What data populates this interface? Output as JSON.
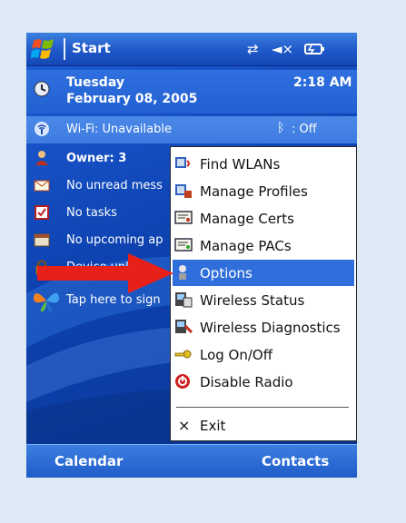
{
  "titlebar": {
    "title": "Start",
    "icons": [
      "windows-flag-icon",
      "connectivity-icon",
      "speaker-muted-icon",
      "battery-icon"
    ]
  },
  "today": {
    "day": "Tuesday",
    "date": "February 08, 2005",
    "time": "2:18 AM",
    "wifi": "Wi-Fi: Unavailable",
    "bluetooth": ": Off",
    "owner": "Owner: 3",
    "messages": "No unread mess",
    "tasks": "No tasks",
    "appointments": "No upcoming ap",
    "device_unlocked": "Device unlo",
    "signin": "Tap here to sign"
  },
  "menu": {
    "items": [
      {
        "label": "Find WLANs",
        "icon": "find-wlans-icon"
      },
      {
        "label": "Manage Profiles",
        "icon": "manage-profiles-icon"
      },
      {
        "label": "Manage Certs",
        "icon": "certificate-icon"
      },
      {
        "label": "Manage PACs",
        "icon": "pac-icon"
      },
      {
        "label": "Options",
        "icon": "options-icon",
        "selected": true
      },
      {
        "label": "Wireless Status",
        "icon": "wireless-status-icon"
      },
      {
        "label": "Wireless Diagnostics",
        "icon": "wireless-diagnostics-icon"
      },
      {
        "label": "Log On/Off",
        "icon": "key-icon"
      },
      {
        "label": "Disable Radio",
        "icon": "disable-radio-icon"
      }
    ],
    "exit_label": "Exit",
    "exit_icon": "×"
  },
  "softkeys": {
    "left": "Calendar",
    "right": "Contacts"
  },
  "colors": {
    "selection": "#2f6fdb",
    "arrow": "#e8201a",
    "accent": "#0d3fa6"
  }
}
